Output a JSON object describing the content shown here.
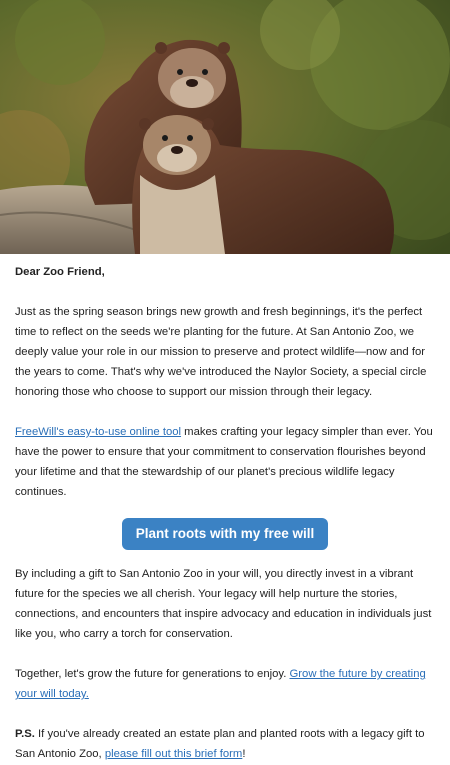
{
  "hero": {
    "image_subject": "two otters sitting on a rock with green foliage background"
  },
  "letter": {
    "greeting": "Dear Zoo Friend,",
    "p1": "Just as the spring season brings new growth and fresh beginnings, it's the perfect time to reflect on the seeds we're planting for the future. At San Antonio Zoo, we deeply value your role in our mission to preserve and protect wildlife—now and for the years to come. That's why we've introduced the Naylor Society, a special circle honoring those who choose to support our mission through their legacy.",
    "p2_link": "FreeWill's easy-to-use online tool",
    "p2_rest": " makes crafting your legacy simpler than ever. You have the power to ensure that your commitment to conservation flourishes beyond your lifetime and that the stewardship of our planet's precious wildlife legacy continues.",
    "cta_label": "Plant roots with my free will",
    "p3": "By including a gift to San Antonio Zoo in your will, you directly invest in a vibrant future for the species we all cherish. Your legacy will help nurture the stories, connections, and encounters that inspire advocacy and education in individuals just like you, who carry a torch for conservation.",
    "p4_text": "Together, let's grow the future for generations to enjoy. ",
    "p4_link": "Grow the future by creating your will today.",
    "ps_label": "P.S.",
    "ps_text": " If you've already created an estate plan and planted roots with a legacy gift to San Antonio Zoo, ",
    "ps_link": "please fill out this brief form",
    "ps_end": "!"
  },
  "colors": {
    "link": "#2a6fb8",
    "cta_background": "#3b82c4",
    "cta_text": "#ffffff"
  }
}
